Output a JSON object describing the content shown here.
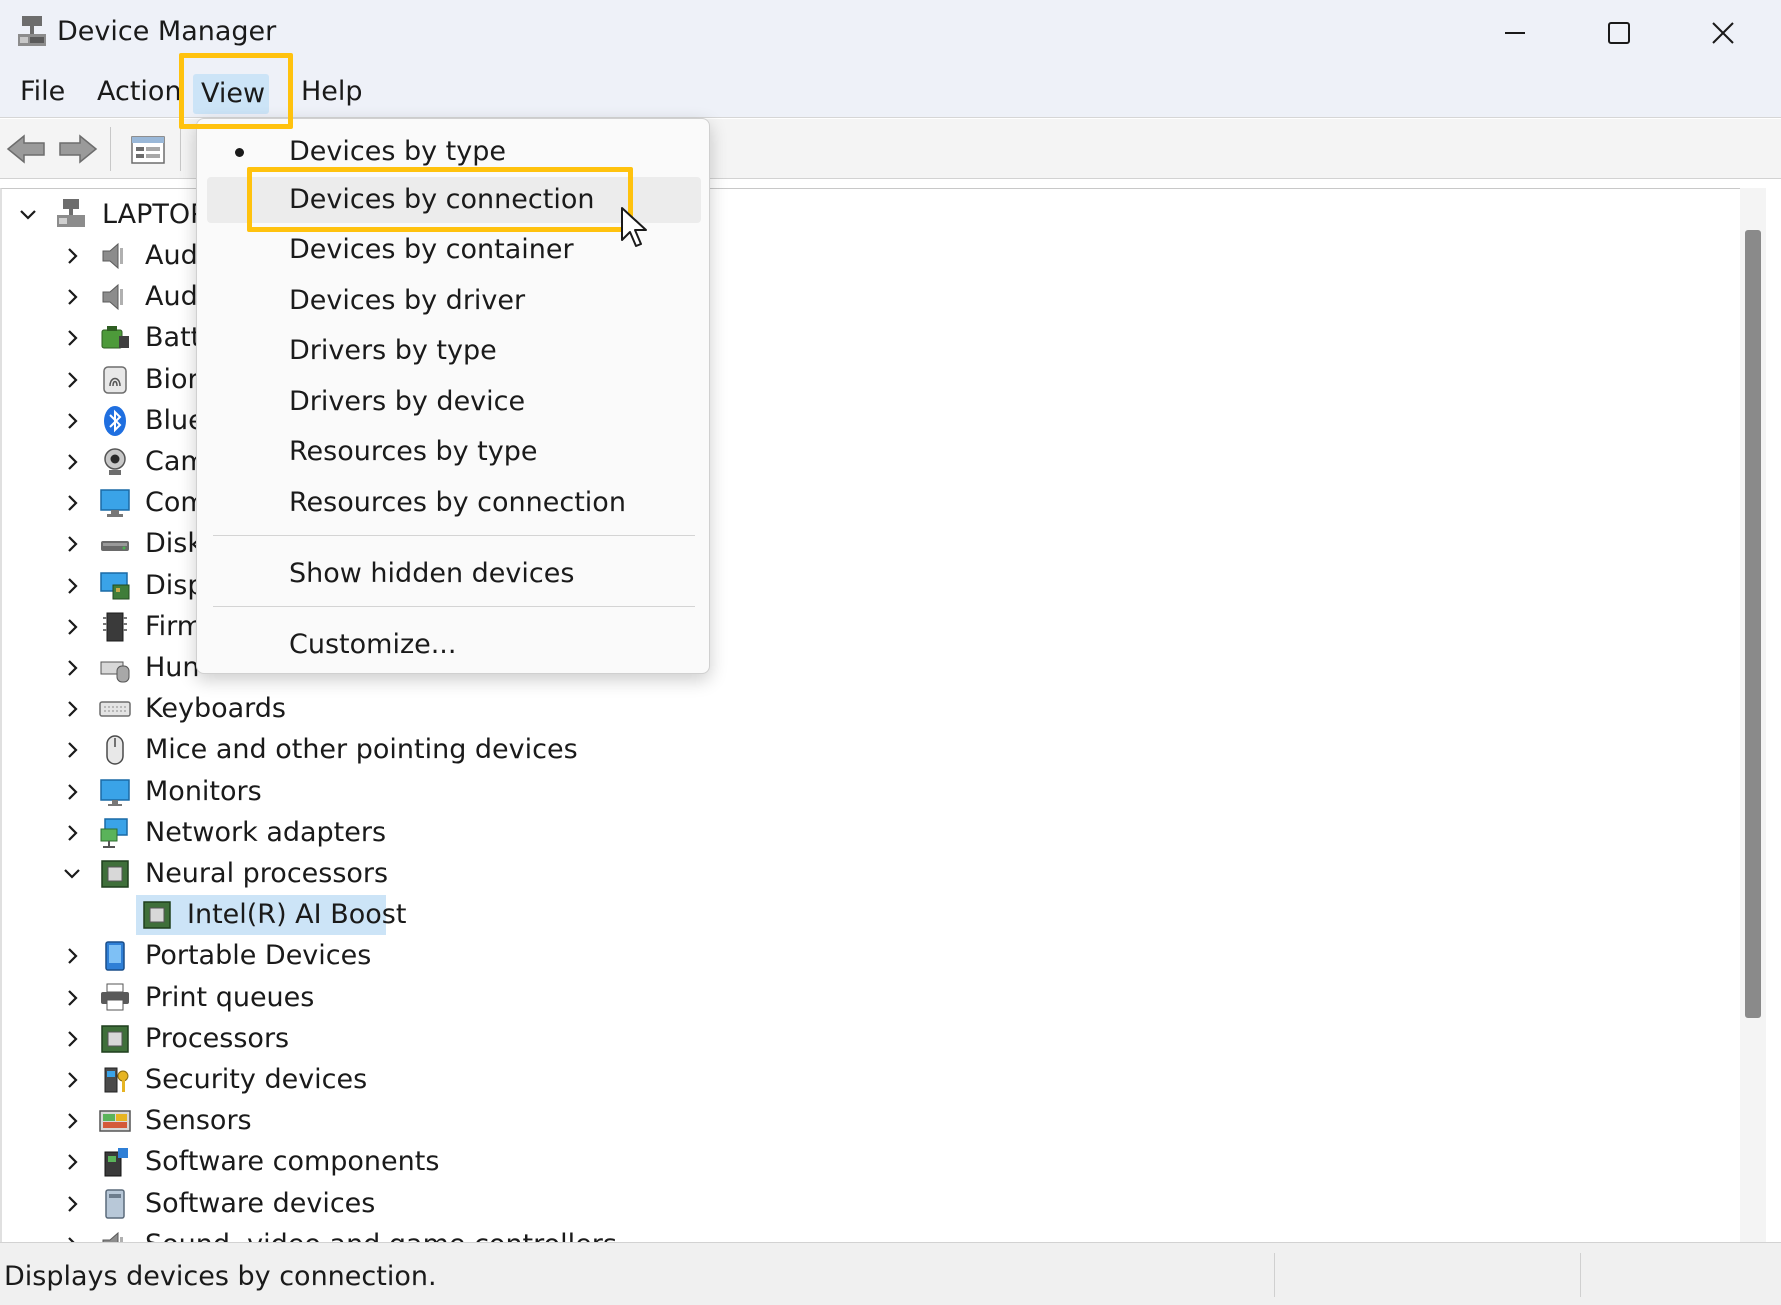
{
  "window": {
    "title": "Device Manager",
    "app_icon": "device-manager-icon",
    "controls": [
      "minimize-icon",
      "maximize-icon",
      "close-icon"
    ]
  },
  "menubar": {
    "items": [
      {
        "label": "File"
      },
      {
        "label": "Action"
      },
      {
        "label": "View"
      },
      {
        "label": "Help"
      }
    ],
    "active": "View"
  },
  "toolbar": {
    "buttons": [
      "back-arrow-icon",
      "forward-arrow-icon",
      "properties-icon"
    ]
  },
  "tree": {
    "root": {
      "label": "LAPTOP-",
      "expanded": true
    },
    "categories": [
      {
        "label": "Aud",
        "icon": "audio-speaker-icon",
        "expanded": false
      },
      {
        "label": "Aud",
        "icon": "audio-speaker-icon",
        "expanded": false
      },
      {
        "label": "Batt",
        "icon": "battery-icon",
        "expanded": false
      },
      {
        "label": "Bior",
        "icon": "biometric-fingerprint-icon",
        "expanded": false
      },
      {
        "label": "Blue",
        "icon": "bluetooth-icon",
        "expanded": false
      },
      {
        "label": "Cam",
        "icon": "camera-icon",
        "expanded": false
      },
      {
        "label": "Com",
        "icon": "computer-monitor-icon",
        "expanded": false
      },
      {
        "label": "Disk",
        "icon": "disk-drive-icon",
        "expanded": false
      },
      {
        "label": "Disp",
        "icon": "display-adapter-icon",
        "expanded": false
      },
      {
        "label": "Firm",
        "icon": "firmware-chip-icon",
        "expanded": false
      },
      {
        "label": "Hun",
        "icon": "hid-keyboard-icon",
        "expanded": false
      },
      {
        "label": "Keyboards",
        "icon": "keyboard-icon",
        "expanded": false
      },
      {
        "label": "Mice and other pointing devices",
        "icon": "mouse-icon",
        "expanded": false
      },
      {
        "label": "Monitors",
        "icon": "monitor-icon",
        "expanded": false
      },
      {
        "label": "Network adapters",
        "icon": "network-adapter-icon",
        "expanded": false
      },
      {
        "label": "Neural processors",
        "icon": "processor-chip-icon",
        "expanded": true
      },
      {
        "label": "Intel(R) AI Boost",
        "icon": "processor-chip-icon",
        "child": true,
        "selected": true
      },
      {
        "label": "Portable Devices",
        "icon": "portable-device-icon",
        "expanded": false
      },
      {
        "label": "Print queues",
        "icon": "printer-icon",
        "expanded": false
      },
      {
        "label": "Processors",
        "icon": "processor-chip-icon",
        "expanded": false
      },
      {
        "label": "Security devices",
        "icon": "security-key-icon",
        "expanded": false
      },
      {
        "label": "Sensors",
        "icon": "sensor-icon",
        "expanded": false
      },
      {
        "label": "Software components",
        "icon": "software-component-icon",
        "expanded": false
      },
      {
        "label": "Software devices",
        "icon": "software-device-icon",
        "expanded": false
      },
      {
        "label": "Sound, video and game controllers",
        "icon": "audio-speaker-icon",
        "expanded": false
      }
    ]
  },
  "view_menu": {
    "items": [
      {
        "label": "Devices by type",
        "checked": true
      },
      {
        "label": "Devices by connection",
        "hovered": true,
        "highlighted": true
      },
      {
        "label": "Devices by container"
      },
      {
        "label": "Devices by driver"
      },
      {
        "label": "Drivers by type"
      },
      {
        "label": "Drivers by device"
      },
      {
        "label": "Resources by type"
      },
      {
        "label": "Resources by connection"
      }
    ],
    "extra": [
      {
        "label": "Show hidden devices"
      },
      {
        "label": "Customize..."
      }
    ]
  },
  "statusbar": {
    "text": "Displays devices by connection."
  },
  "colors": {
    "titlebar": "#eef1f8",
    "menu_active": "#cce4f7",
    "selection": "#cce4f7",
    "highlight_box": "#ffc20e",
    "scroll_thumb": "#8a8a8a"
  }
}
